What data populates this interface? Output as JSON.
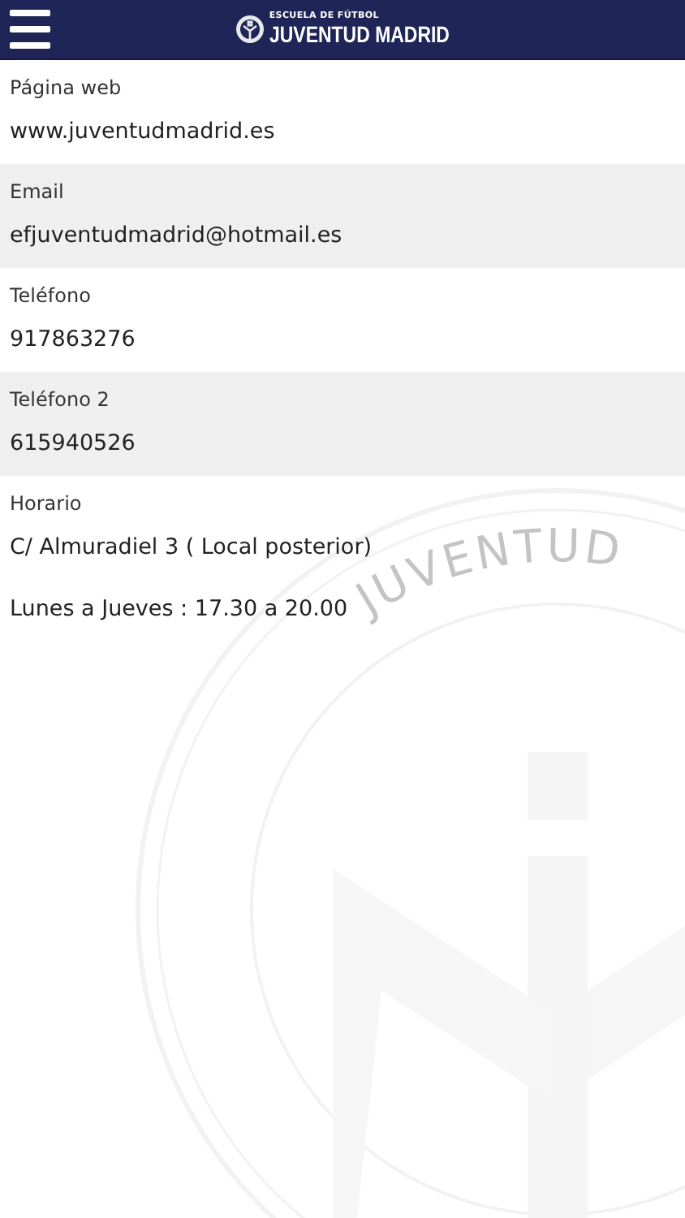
{
  "header": {
    "subtitle": "ESCUELA DE FÚTBOL",
    "title": "JUVENTUD MADRID"
  },
  "fields": [
    {
      "label": "Página web",
      "values": [
        "www.juventudmadrid.es"
      ]
    },
    {
      "label": "Email",
      "values": [
        "efjuventudmadrid@hotmail.es"
      ]
    },
    {
      "label": "Teléfono",
      "values": [
        "917863276"
      ]
    },
    {
      "label": "Teléfono 2",
      "values": [
        "615940526"
      ]
    },
    {
      "label": "Horario",
      "values": [
        "C/ Almuradiel 3 ( Local posterior)",
        "Lunes a Jueves : 17.30 a 20.00"
      ]
    }
  ],
  "background_crest": {
    "text": "JUVENTUD"
  }
}
